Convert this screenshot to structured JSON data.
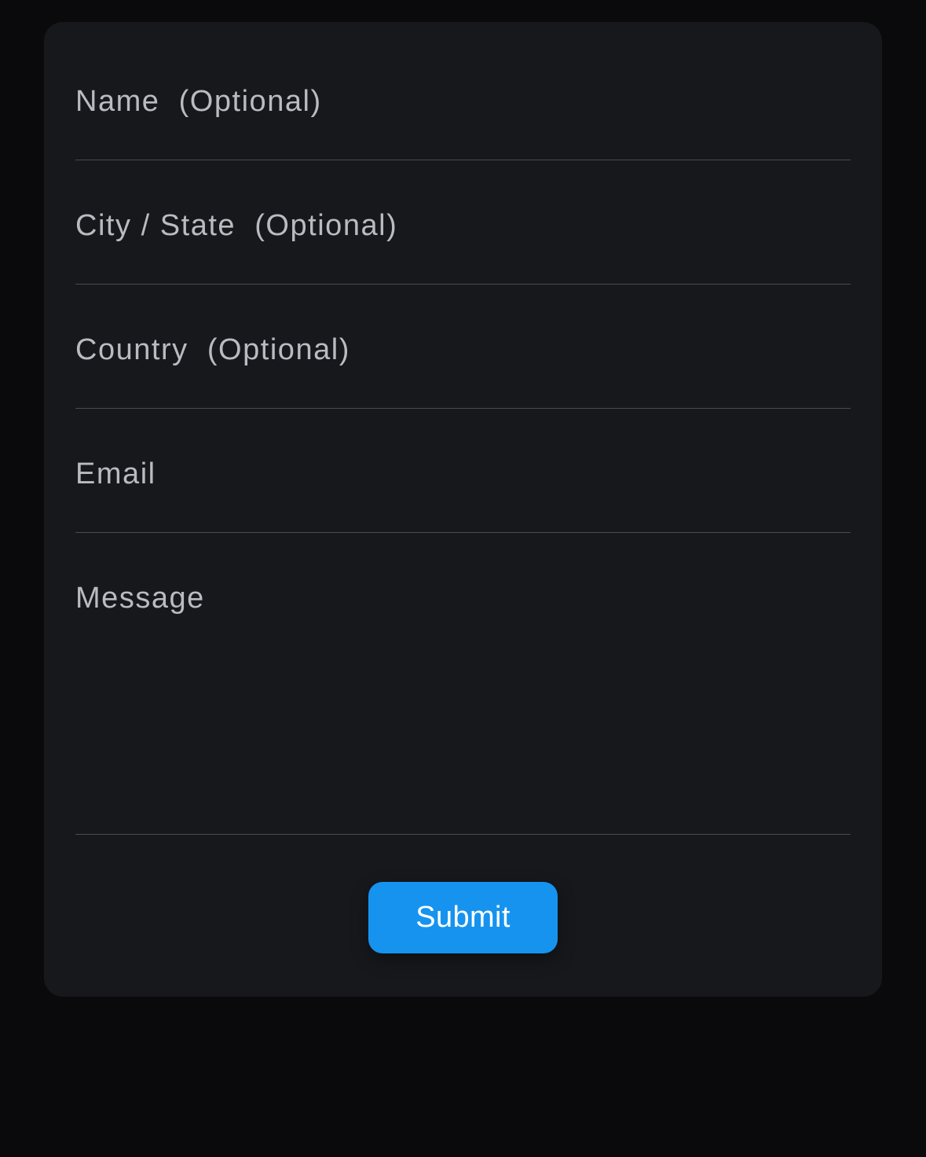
{
  "form": {
    "fields": {
      "name": {
        "placeholder": "Name  (Optional)",
        "value": ""
      },
      "city_state": {
        "placeholder": "City / State  (Optional)",
        "value": ""
      },
      "country": {
        "placeholder": "Country  (Optional)",
        "value": ""
      },
      "email": {
        "placeholder": "Email",
        "value": ""
      },
      "message": {
        "placeholder": "Message",
        "value": ""
      }
    },
    "submit_label": "Submit"
  },
  "colors": {
    "accent": "#1693ef",
    "card_bg": "#17181c",
    "page_bg": "#0a0a0d",
    "text_muted": "#b9bbc0",
    "border": "#4a4a50"
  }
}
